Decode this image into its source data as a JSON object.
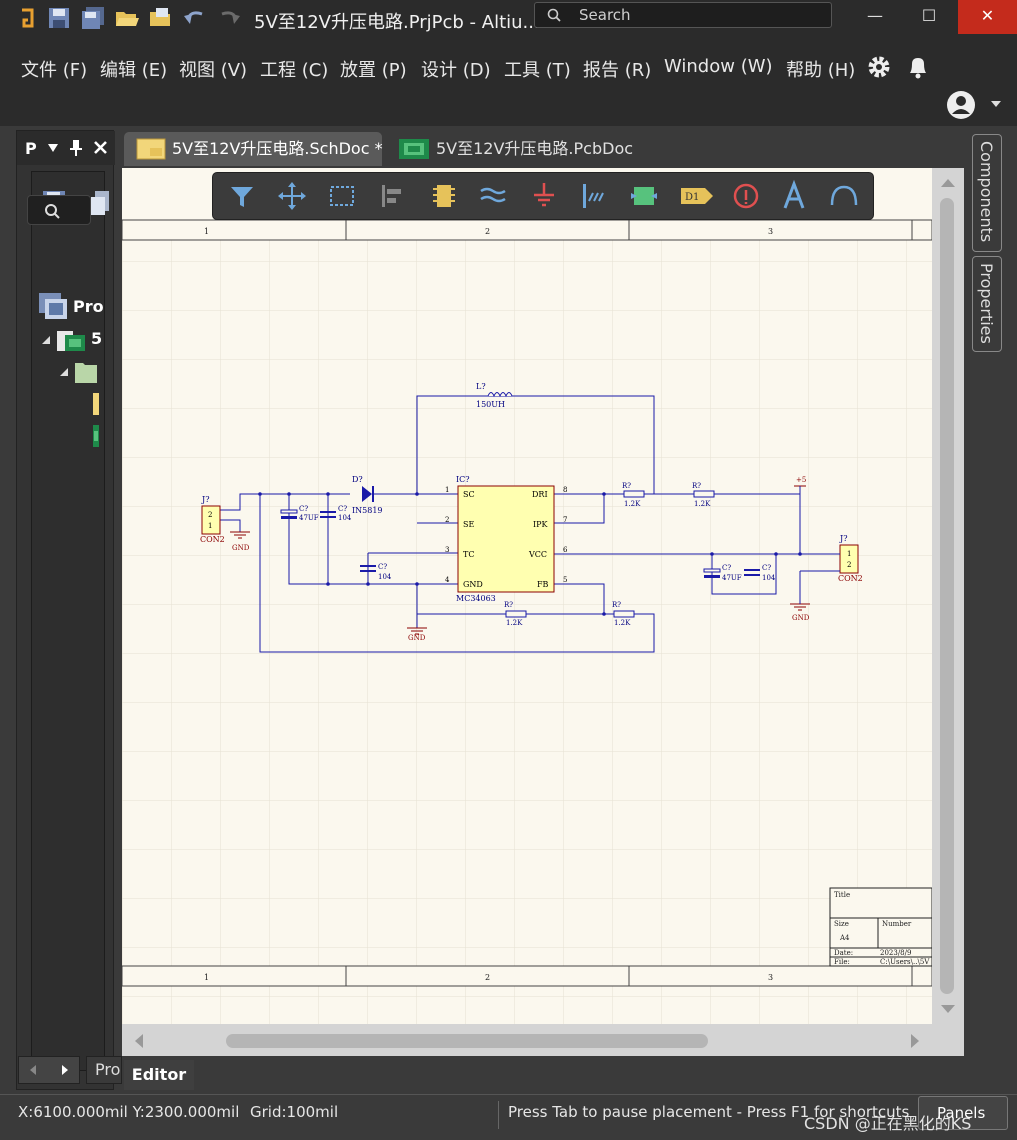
{
  "titlebar": {
    "title": "5V至12V升压电路.PrjPcb - Altiu...",
    "search_placeholder": "Search",
    "minimize_label": "—",
    "maximize_label": "☐",
    "close_label": "✕"
  },
  "menubar": {
    "items": [
      {
        "label": "文件 (F)"
      },
      {
        "label": "编辑 (E)"
      },
      {
        "label": "视图 (V)"
      },
      {
        "label": "工程 (C)"
      },
      {
        "label": "放置 (P)"
      },
      {
        "label": "设计 (D)"
      },
      {
        "label": "工具 (T)"
      },
      {
        "label": "报告 (R)"
      },
      {
        "label": "Window (W)"
      },
      {
        "label": "帮助 (H)"
      }
    ]
  },
  "left_panel": {
    "title": "P",
    "tree_root": "Pro",
    "tree_child": "5",
    "bottom_tab": "Pro"
  },
  "doc_tabs": [
    {
      "label": "5V至12V升压电路.SchDoc *"
    },
    {
      "label": "5V至12V升压电路.PcbDoc"
    }
  ],
  "editor_tab": "Editor",
  "right_panel": {
    "tabs": [
      {
        "label": "Components"
      },
      {
        "label": "Properties"
      }
    ]
  },
  "schematic": {
    "zones_top": [
      "1",
      "2",
      "3"
    ],
    "zones_bottom": [
      "1",
      "2",
      "3"
    ],
    "ic": {
      "ref": "IC?",
      "part": "MC34063",
      "pins_left": [
        {
          "num": "1",
          "name": "SC"
        },
        {
          "num": "2",
          "name": "SE"
        },
        {
          "num": "3",
          "name": "TC"
        },
        {
          "num": "4",
          "name": "GND"
        }
      ],
      "pins_right": [
        {
          "num": "8",
          "name": "DRI"
        },
        {
          "num": "7",
          "name": "IPK"
        },
        {
          "num": "6",
          "name": "VCC"
        },
        {
          "num": "5",
          "name": "FB"
        }
      ]
    },
    "inductor": {
      "ref": "L?",
      "value": "150UH"
    },
    "diode": {
      "ref": "D?",
      "value": "IN5819"
    },
    "j_in": {
      "ref": "J?",
      "value": "CON2",
      "pin_top": "2",
      "pin_bottom": "1"
    },
    "j_out": {
      "ref": "J?",
      "value": "CON2",
      "pin_top": "1",
      "pin_bottom": "2"
    },
    "c1": {
      "ref": "C?",
      "value": "47UF"
    },
    "c2": {
      "ref": "C?",
      "value": "104"
    },
    "c3": {
      "ref": "C?",
      "value": "104"
    },
    "c4": {
      "ref": "C?",
      "value": "47UF"
    },
    "c5": {
      "ref": "C?",
      "value": "104"
    },
    "r1": {
      "ref": "R?",
      "value": "1.2K"
    },
    "r2": {
      "ref": "R?",
      "value": "1.2K"
    },
    "r3": {
      "ref": "R?",
      "value": "1.2K"
    },
    "r4": {
      "ref": "R?",
      "value": "1.2K"
    },
    "gnd_label": "GND",
    "vcc_label": "+5",
    "titleblock": {
      "title_label": "Title",
      "size_label": "Size",
      "size_value": "A4",
      "number_label": "Number",
      "date_label": "Date:",
      "date_value": "2023/8/9",
      "file_label": "File:",
      "file_value": "C:\\Users\\..\\5V"
    }
  },
  "statusbar": {
    "coords": "X:6100.000mil Y:2300.000mil",
    "grid": "Grid:100mil",
    "hint": "Press Tab to pause placement - Press F1 for shortcuts",
    "panels_label": "Panels"
  },
  "watermark": "CSDN @正在黑化的KS",
  "colors": {
    "wire": "#1a1aa8",
    "component_fill": "#ffffb0",
    "component_border": "#8b0000",
    "close": "#c42b1c"
  }
}
